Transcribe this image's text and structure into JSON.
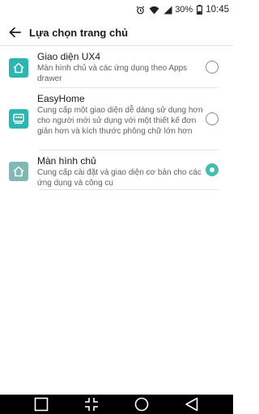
{
  "status_bar": {
    "battery_percent": "30%",
    "time": "10:45",
    "icons": [
      "alarm-icon",
      "wifi-icon",
      "signal-icon",
      "battery-icon"
    ]
  },
  "header": {
    "back_icon": "arrow-back-icon",
    "title": "Lựa chọn trang chủ"
  },
  "home_options": [
    {
      "name": "Giao diện UX4",
      "description": "Màn hình chủ và các ứng dụng theo Apps drawer",
      "icon": "home-icon",
      "selected": false
    },
    {
      "name": "EasyHome",
      "description": "Cung cấp một giao diện dễ dàng sử dụng hơn cho người mới sử dụng với một thiết kế đơn giản hơn và kích thước phông chữ lớn hơn",
      "icon": "easyhome-icon",
      "selected": false
    },
    {
      "name": "Màn hình chủ",
      "description": "Cung cấp cài đặt và giao diện cơ bản cho các ứng dụng và công cụ",
      "icon": "home-icon",
      "selected": true
    }
  ],
  "colors": {
    "accent": "#3fbfb0",
    "icon_teal": "#2bb6b0",
    "icon_muted": "#7fb8b4",
    "navbar": "#000000"
  },
  "nav_bar": {
    "buttons": [
      "recent-apps-icon",
      "dual-window-icon",
      "home-circle-icon",
      "back-triangle-icon"
    ]
  }
}
